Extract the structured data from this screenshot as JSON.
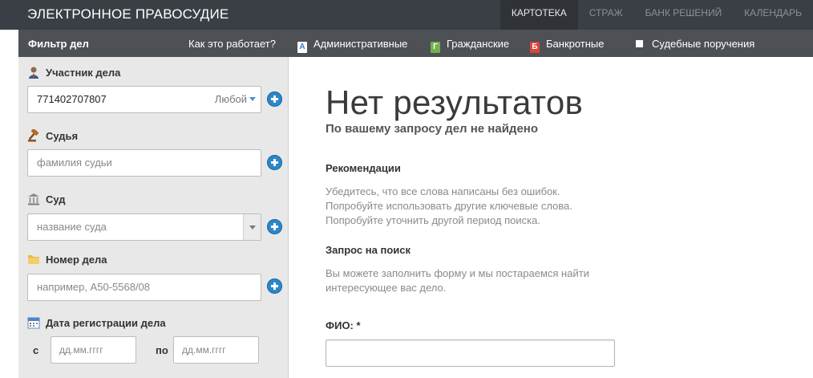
{
  "header": {
    "brand": "ЭЛЕКТРОННОЕ ПРАВОСУДИЕ",
    "nav": [
      {
        "label": "КАРТОТЕКА",
        "active": true
      },
      {
        "label": "СТРАЖ"
      },
      {
        "label": "БАНК РЕШЕНИЙ"
      },
      {
        "label": "КАЛЕНДАРЬ"
      }
    ]
  },
  "subbar": {
    "filter_title": "Фильтр дел",
    "how_link": "Как это работает?",
    "categories": [
      {
        "badge": "А",
        "label": "Административные",
        "color": "#3d7fd0"
      },
      {
        "badge": "Г",
        "label": "Гражданские",
        "color": "#76b04a"
      },
      {
        "badge": "Б",
        "label": "Банкротные",
        "color": "#d9453a"
      },
      {
        "label": "Судебные поручения"
      }
    ]
  },
  "filters": {
    "participant": {
      "label": "Участник дела",
      "value": "771402707807",
      "mode": "Любой"
    },
    "judge": {
      "label": "Судья",
      "placeholder": "фамилия судьи"
    },
    "court": {
      "label": "Суд",
      "placeholder": "название суда"
    },
    "case_number": {
      "label": "Номер дела",
      "placeholder": "например, А50-5568/08"
    },
    "date": {
      "label": "Дата регистрации дела",
      "from_label": "с",
      "to_label": "по",
      "from_placeholder": "дд.мм.гггг",
      "to_placeholder": "дд.мм.гггг"
    }
  },
  "main": {
    "title": "Нет результатов",
    "subtitle": "По вашему запросу дел не найдено",
    "recommendations": {
      "heading": "Рекомендации",
      "lines": [
        "Убедитесь, что все слова написаны без ошибок.",
        "Попробуйте использовать другие ключевые слова.",
        "Попробуйте уточнить другой период поиска."
      ]
    },
    "search_request": {
      "heading": "Запрос на поиск",
      "lines": [
        "Вы можете заполнить форму и мы постараемся найти",
        "интересующее вас дело."
      ]
    },
    "fio_label": "ФИО: *"
  }
}
